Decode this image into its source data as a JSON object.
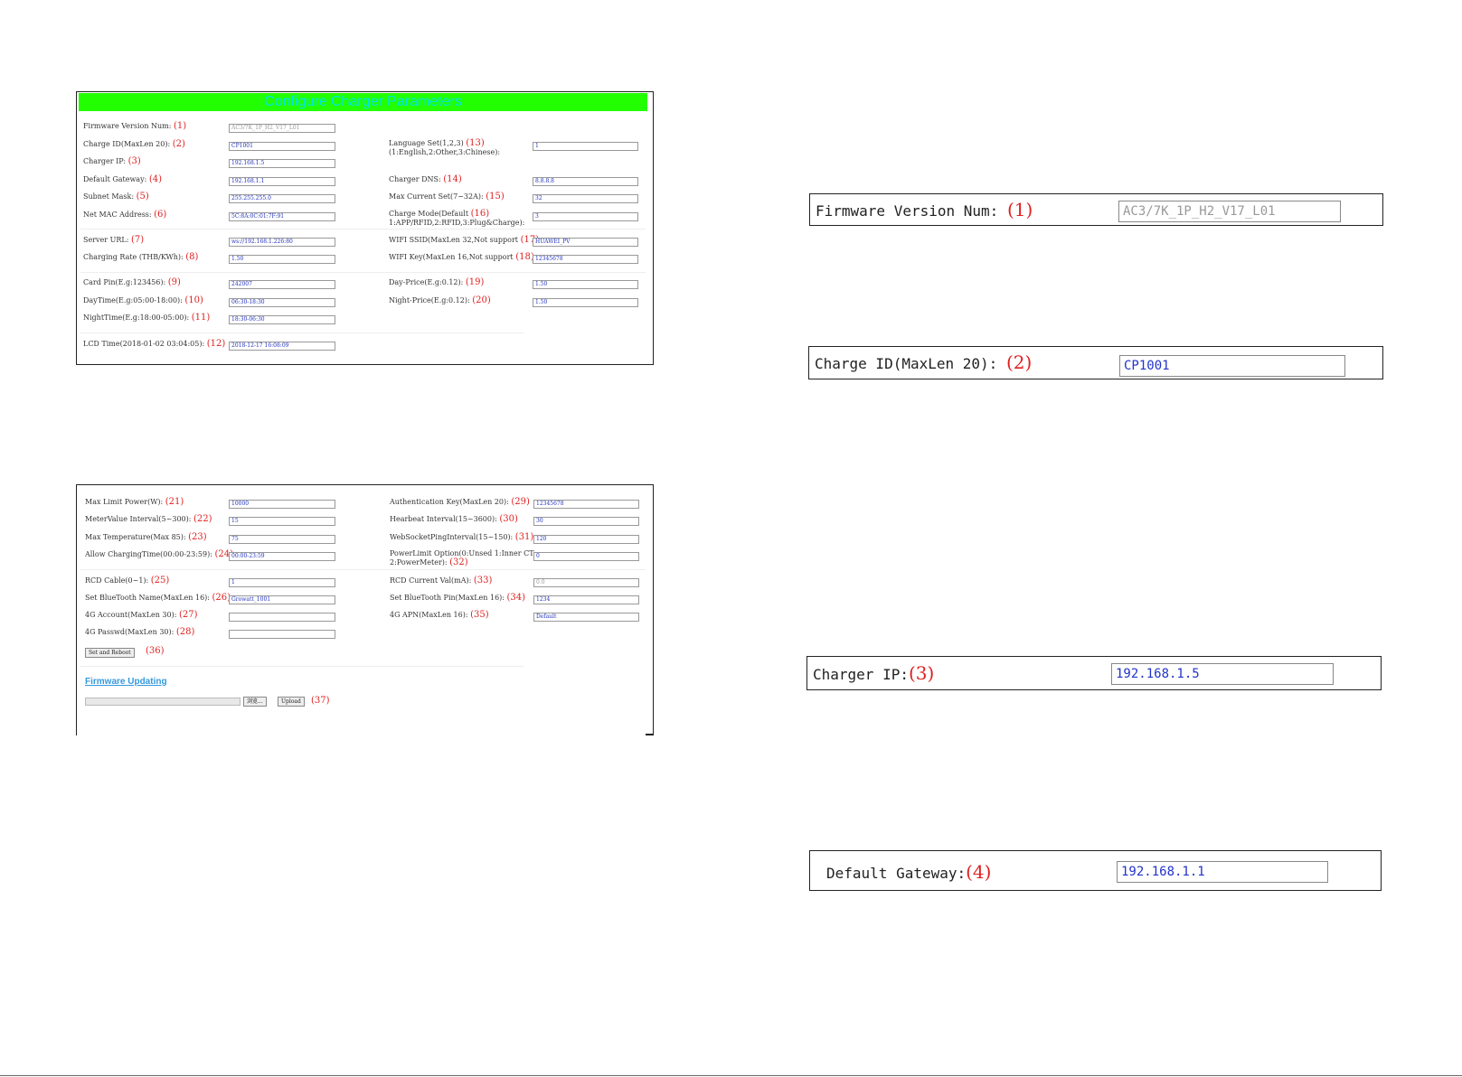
{
  "title": "Configure Charger Parameters",
  "panel1": {
    "left_fields": [
      {
        "label": "Firmware Version Num:",
        "num": "(1)",
        "value": "AC3/7K_1P_H2_V17_L01",
        "readonly": true
      },
      {
        "label": "Charge ID(MaxLen 20):",
        "num": "(2)",
        "value": "CP1001"
      },
      {
        "label": "Charger IP:",
        "num": "(3)",
        "value": "192.168.1.5"
      },
      {
        "label": "Default Gateway:",
        "num": "(4)",
        "value": "192.168.1.1"
      },
      {
        "label": "Subnet Mask:",
        "num": "(5)",
        "value": "255.255.255.0"
      },
      {
        "label": "Net MAC Address:",
        "num": "(6)",
        "value": "5C:8A:0C:01:7F:91"
      },
      {
        "label": "Server URL:",
        "num": "(7)",
        "value": "ws://192.168.1.226:80"
      },
      {
        "label": "Charging Rate (THB/KWh):",
        "num": "(8)",
        "value": "1.50"
      },
      {
        "label": "Card Pin(E.g:123456):",
        "num": "(9)",
        "value": "242007"
      },
      {
        "label": "DayTime(E.g:05:00-18:00):",
        "num": "(10)",
        "value": "06:30-18:30"
      },
      {
        "label": "NightTime(E.g:18:00-05:00):",
        "num": "(11)",
        "value": "18:30-06:30"
      },
      {
        "label": "LCD Time(2018-01-02 03:04:05):",
        "num": "(12)",
        "value": "2018-12-17 16:08:09"
      }
    ],
    "right_fields": [
      {
        "label": "Language Set(1,2,3)",
        "num": "(13)",
        "sub": "(1:English,2:Other,3:Chinese):",
        "value": "1"
      },
      {
        "label": "Charger DNS:",
        "num": "(14)",
        "value": "8.8.8.8"
      },
      {
        "label": "Max Current Set(7~32A):",
        "num": "(15)",
        "value": "32"
      },
      {
        "label": "Charge Mode(Default",
        "num": "(16)",
        "sub": "1:APP/RFID,2:RFID,3:Plug&Charge):",
        "value": "3"
      },
      {
        "label": "WIFI SSID(MaxLen 32,Not support",
        "num": "(17)",
        "value": "HUAWEI_PV"
      },
      {
        "label": "WIFI Key(MaxLen 16,Not support",
        "num": "(18)",
        "value": "12345678"
      },
      {
        "label": "Day-Price(E.g:0.12):",
        "num": "(19)",
        "value": "1.50"
      },
      {
        "label": "Night-Price(E.g:0.12):",
        "num": "(20)",
        "value": "1.50"
      }
    ]
  },
  "panel2": {
    "left_fields": [
      {
        "label": "Max Limit Power(W):",
        "num": "(21)",
        "value": "10000"
      },
      {
        "label": "MeterValue Interval(5~300):",
        "num": "(22)",
        "value": "15"
      },
      {
        "label": "Max Temperature(Max 85):",
        "num": "(23)",
        "value": "75"
      },
      {
        "label": "Allow ChargingTime(00:00-23:59):",
        "num": "(24)",
        "value": "00:00-23:59"
      },
      {
        "label": "RCD Cable(0~1):",
        "num": "(25)",
        "value": "1"
      },
      {
        "label": "Set BlueTooth Name(MaxLen 16):",
        "num": "(26)",
        "value": "Growatt_1001"
      },
      {
        "label": "4G Account(MaxLen 30):",
        "num": "(27)",
        "value": ""
      },
      {
        "label": "4G Passwd(MaxLen 30):",
        "num": "(28)",
        "value": ""
      }
    ],
    "right_fields": [
      {
        "label": "Authentication Key(MaxLen 20):",
        "num": "(29)",
        "value": "12345678"
      },
      {
        "label": "Hearbeat Interval(15~3600):",
        "num": "(30)",
        "value": "30"
      },
      {
        "label": "WebSocketPingInterval(15~150):",
        "num": "(31)",
        "value": "120"
      },
      {
        "label": "PowerLimit Option(0:Unsed 1:Inner CT",
        "num": "(32)",
        "sub": "2:PowerMeter):",
        "value": "0"
      },
      {
        "label": "RCD Current Val(mA):",
        "num": "(33)",
        "value": "0.0",
        "readonly": true
      },
      {
        "label": "Set BlueTooth Pin(MaxLen 16):",
        "num": "(34)",
        "value": "1234"
      },
      {
        "label": "4G APN(MaxLen 16):",
        "num": "(35)",
        "value": "Default"
      }
    ],
    "set_reboot_label": "Set and Reboot",
    "set_reboot_num": "(36)",
    "firmware_link": "Firmware Updating",
    "browse_label": "浏览...",
    "upload_label": "Upload",
    "upload_num": "(37)"
  },
  "zooms": [
    {
      "label": "Firmware Version Num:",
      "num": "(1)",
      "value": "AC3/7K_1P_H2_V17_L01",
      "readonly": true
    },
    {
      "label": "Charge ID(MaxLen 20):",
      "num": "(2)",
      "value": "CP1001"
    },
    {
      "label": "Charger IP:",
      "num": "(3)",
      "value": "192.168.1.5"
    },
    {
      "label": "Default Gateway:",
      "num": "(4)",
      "value": "192.168.1.1"
    }
  ]
}
